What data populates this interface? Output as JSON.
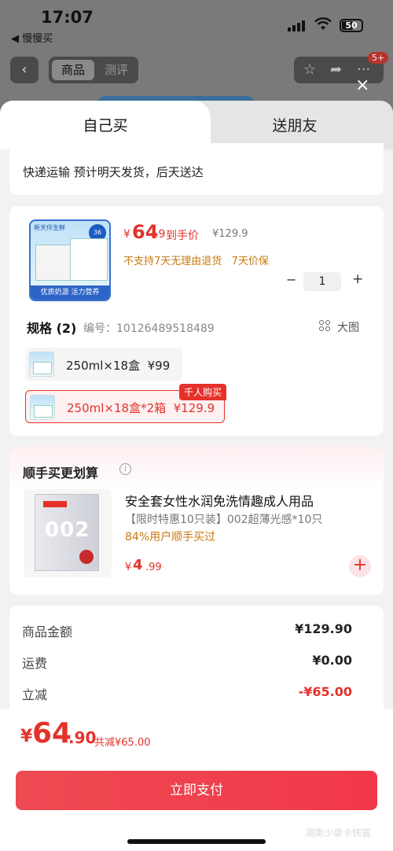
{
  "status_bar": {
    "time": "17:07",
    "back_app": "◀ 慢慢买",
    "battery": "50"
  },
  "nav": {
    "back_icon": "‹",
    "segment_active": "商品",
    "segment_inactive": "测评",
    "badge": "5+",
    "close": "×"
  },
  "tabs": {
    "active": "自己买",
    "inactive": "送朋友"
  },
  "shipping": {
    "text": "快递运输 预计明天发货，后天送达"
  },
  "product": {
    "price_symbol": "¥",
    "price_int": "64",
    "price_dec": ".9",
    "price_label": "到手价",
    "original_price": "¥129.9",
    "notes": "不支持7天无理由退货   7天价保",
    "quantity": "1",
    "minus": "−",
    "plus": "+",
    "thumb_top": "新天伴生鲜",
    "thumb_strip": "优质奶源 活力营养",
    "thumb_seal": "36",
    "spec_title": "规格 (2)",
    "spec_code": "编号：10126489518489",
    "big_picture": "大图",
    "options": [
      {
        "label": "250ml×18盒  ¥99",
        "selected": false
      },
      {
        "label": "250ml×18盒*2箱  ¥129.9",
        "selected": true
      }
    ],
    "option_tag": "千人购买"
  },
  "promo": {
    "title": "顺手买更划算",
    "info_icon": "i",
    "name": "安全套女性水润免洗情趣成人用品",
    "subtitle": "【限时特惠10只装】002超薄光感*10只",
    "stat": "84%用户顺手买过",
    "price_symbol": "¥",
    "price_int": "4",
    "price_dec": ".99",
    "pkg_text": "002",
    "add": "+"
  },
  "summary": {
    "rows": [
      {
        "label": "商品金额",
        "value": "¥129.90"
      },
      {
        "label": "运费",
        "value": "¥0.00"
      },
      {
        "label": "立减",
        "value": "-¥65.00"
      }
    ]
  },
  "footer": {
    "price_symbol": "¥",
    "price_int": "64",
    "price_dec": ".90",
    "savings": "共减¥65.00",
    "pay_button": "立即支付",
    "watermark": "湖南少录卡快富"
  },
  "colors": {
    "accent": "#e4322b",
    "note": "#c77a10"
  }
}
